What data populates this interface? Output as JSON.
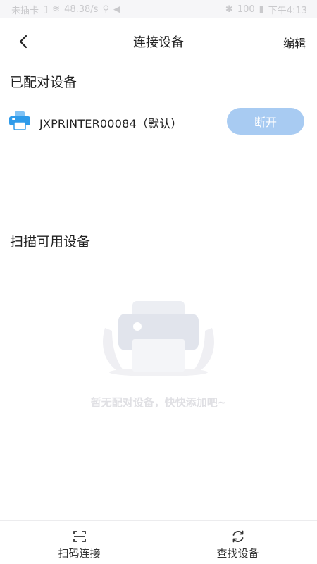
{
  "status_bar": {
    "carrier": "未插卡",
    "speed": "48.38/s",
    "battery": "100",
    "time": "下午4:13"
  },
  "header": {
    "title": "连接设备",
    "edit_label": "编辑"
  },
  "paired_section": {
    "title": "已配对设备",
    "devices": [
      {
        "name": "JXPRINTER00084（默认）",
        "action_label": "断开"
      }
    ]
  },
  "scan_section": {
    "title": "扫描可用设备",
    "empty_text": "暂无配对设备，快快添加吧~"
  },
  "bottom_bar": {
    "scan_label": "扫码连接",
    "search_label": "查找设备"
  },
  "colors": {
    "accent": "#a8cbf2",
    "printer_blue": "#2f9bea",
    "empty_gray": "#e0e0e4"
  }
}
